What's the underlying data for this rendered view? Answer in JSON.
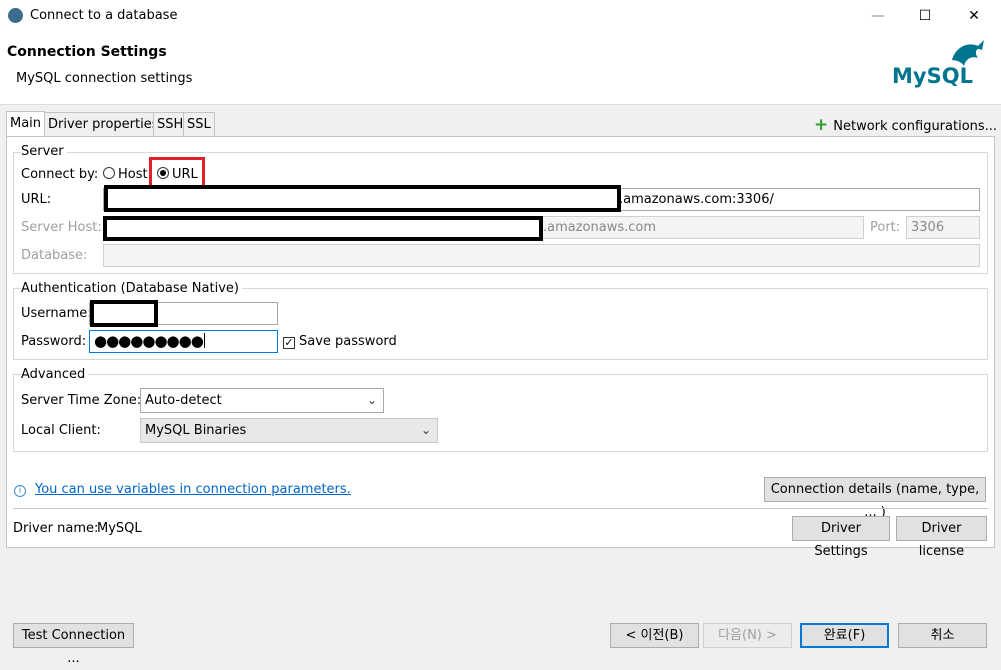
{
  "window": {
    "title": "Connect to a database",
    "minimize_glyph": "—",
    "maximize_glyph": "☐",
    "close_glyph": "✕"
  },
  "header": {
    "title": "Connection Settings",
    "subtitle": "MySQL connection settings",
    "logo_text": "MySQL",
    "logo_color": "#00758f",
    "logo_accent": "#f29111"
  },
  "tabs": [
    "Main",
    "Driver properties",
    "SSH",
    "SSL"
  ],
  "network_config": {
    "label": "Network configurations...",
    "icon": "plus-icon"
  },
  "server": {
    "group_label": "Server",
    "connect_by_label": "Connect by:",
    "options": [
      "Host",
      "URL"
    ],
    "selected": "URL",
    "url_label": "URL:",
    "url_value": ".amazonaws.com:3306/",
    "host_label": "Server Host:",
    "host_value": ".amazonaws.com",
    "port_label": "Port:",
    "port_value": "3306",
    "database_label": "Database:",
    "database_value": ""
  },
  "auth": {
    "group_label": "Authentication (Database Native)",
    "username_label": "Username:",
    "password_label": "Password:",
    "password_value": "●●●●●●●●●",
    "save_password_label": "Save password",
    "save_password_checked": "✓"
  },
  "advanced": {
    "group_label": "Advanced",
    "timezone_label": "Server Time Zone:",
    "timezone_value": "Auto-detect",
    "local_client_label": "Local Client:",
    "local_client_value": "MySQL Binaries"
  },
  "info": {
    "icon": "info-icon",
    "link_text": "You can use variables in connection parameters.",
    "details_button": "Connection details (name, type, ... )"
  },
  "driver": {
    "name_label": "Driver name:",
    "name_value": "MySQL",
    "settings_button": "Driver Settings",
    "license_button": "Driver license"
  },
  "footer": {
    "test_button": "Test Connection ...",
    "back_button": "< 이전(B)",
    "next_button": "다음(N) >",
    "finish_button": "완료(F)",
    "cancel_button": "취소"
  },
  "colors": {
    "highlight_box": "#e0202a",
    "focus_border": "#0078d7"
  }
}
